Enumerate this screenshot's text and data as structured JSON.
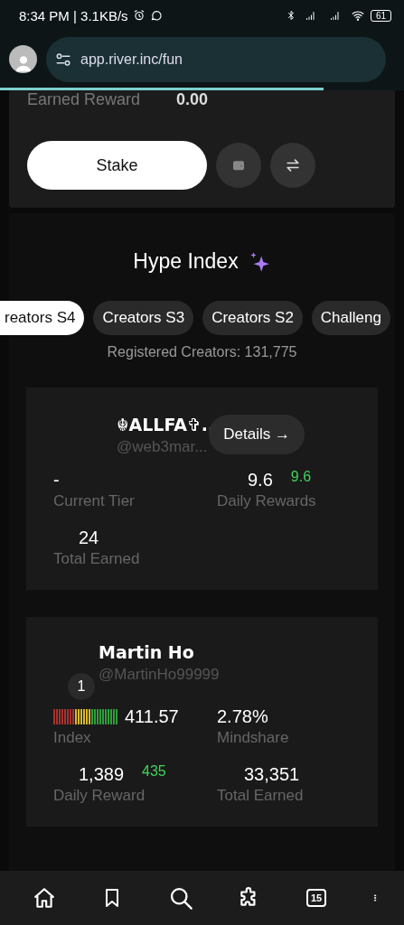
{
  "status_bar": {
    "time_speed": "8:34 PM | 3.1KB/s",
    "battery": "61"
  },
  "browser": {
    "url": "app.river.inc/fun",
    "progress": {
      "level": 0.8
    }
  },
  "stake_panel": {
    "label": "Earned Reward",
    "value": "0.00",
    "stake_button": "Stake"
  },
  "hype_index": {
    "title": "Hype Index",
    "tabs": [
      {
        "label": "reators S4",
        "selected": true
      },
      {
        "label": "Creators S3",
        "selected": false
      },
      {
        "label": "Creators S2",
        "selected": false
      },
      {
        "label": "Challeng",
        "selected": false
      }
    ],
    "registered": "Registered Creators: 131,775",
    "my_card": {
      "name": "☬ALLFA✞..",
      "handle": "@web3mar...",
      "details_button": "Details →",
      "stats": [
        {
          "value": "-",
          "label": "Current Tier"
        },
        {
          "value": "9.6",
          "delta": "9.6",
          "label": "Daily Rewards"
        },
        {
          "value": "24",
          "label": "Total Earned"
        }
      ]
    },
    "leaders": [
      {
        "rank": "1",
        "name": "Martin Ho",
        "handle": "@MartinHo99999",
        "index_meter": {
          "level": 1
        },
        "stats": [
          {
            "value": "411.57",
            "label": "Index",
            "kind": "meter"
          },
          {
            "value": "2.78%",
            "label": "Mindshare",
            "kind": "plain"
          },
          {
            "value": "1,389",
            "delta": "435",
            "label": "Daily Reward",
            "kind": "plain"
          },
          {
            "value": "33,351",
            "label": "Total Earned",
            "kind": "plain"
          }
        ]
      }
    ]
  },
  "bottom_nav": {
    "tab_count": "15"
  }
}
